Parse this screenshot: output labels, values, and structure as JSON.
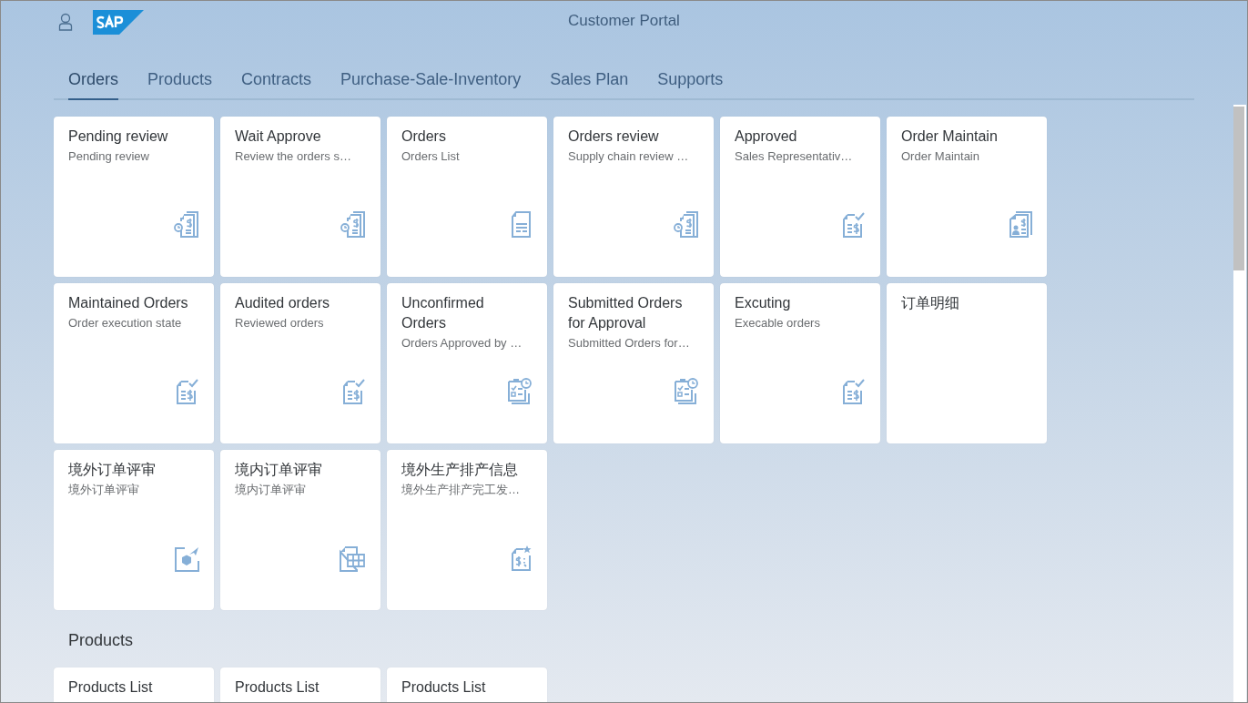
{
  "header": {
    "title": "Customer Portal"
  },
  "tabs": [
    {
      "label": "Orders",
      "selected": true
    },
    {
      "label": "Products",
      "selected": false
    },
    {
      "label": "Contracts",
      "selected": false
    },
    {
      "label": "Purchase-Sale-Inventory",
      "selected": false
    },
    {
      "label": "Sales Plan",
      "selected": false
    },
    {
      "label": "Supports",
      "selected": false
    }
  ],
  "groups": [
    {
      "tiles": [
        {
          "title": "Pending review",
          "subtitle": "Pending review",
          "kind": "clock"
        },
        {
          "title": "Wait Approve",
          "subtitle": "Review the orders s…",
          "kind": "clock"
        },
        {
          "title": "Orders",
          "subtitle": "Orders List",
          "kind": "list"
        },
        {
          "title": "Orders review",
          "subtitle": "Supply chain review …",
          "kind": "clock"
        },
        {
          "title": "Approved",
          "subtitle": "Sales Representativ…",
          "kind": "check"
        },
        {
          "title": "Order Maintain",
          "subtitle": "Order Maintain",
          "kind": "person"
        },
        {
          "title": "Maintained Orders",
          "subtitle": "Order execution state",
          "kind": "check"
        },
        {
          "title": "Audited orders",
          "subtitle": "Reviewed orders",
          "kind": "check"
        },
        {
          "title": "Unconfirmed Orders",
          "subtitle": "Orders Approved by …",
          "kind": "clipboard"
        },
        {
          "title": "Submitted Orders for Approval",
          "subtitle": "Submitted Orders for…",
          "kind": "clipboard"
        },
        {
          "title": "Excuting",
          "subtitle": "Execable orders",
          "kind": "check"
        },
        {
          "title": "订单明细"
        },
        {
          "title": "境外订单评审",
          "subtitle": "境外订单评审",
          "kind": "box"
        },
        {
          "title": "境内订单评审",
          "subtitle": "境内订单评审",
          "kind": "grid"
        },
        {
          "title": "境外生产排产信息",
          "subtitle": "境外生产排产完工发…",
          "kind": "star"
        }
      ]
    },
    {
      "heading": "Products",
      "tiles": [
        {
          "title": "Products List"
        },
        {
          "title": "Products List"
        },
        {
          "title": "Products List"
        }
      ]
    }
  ]
}
